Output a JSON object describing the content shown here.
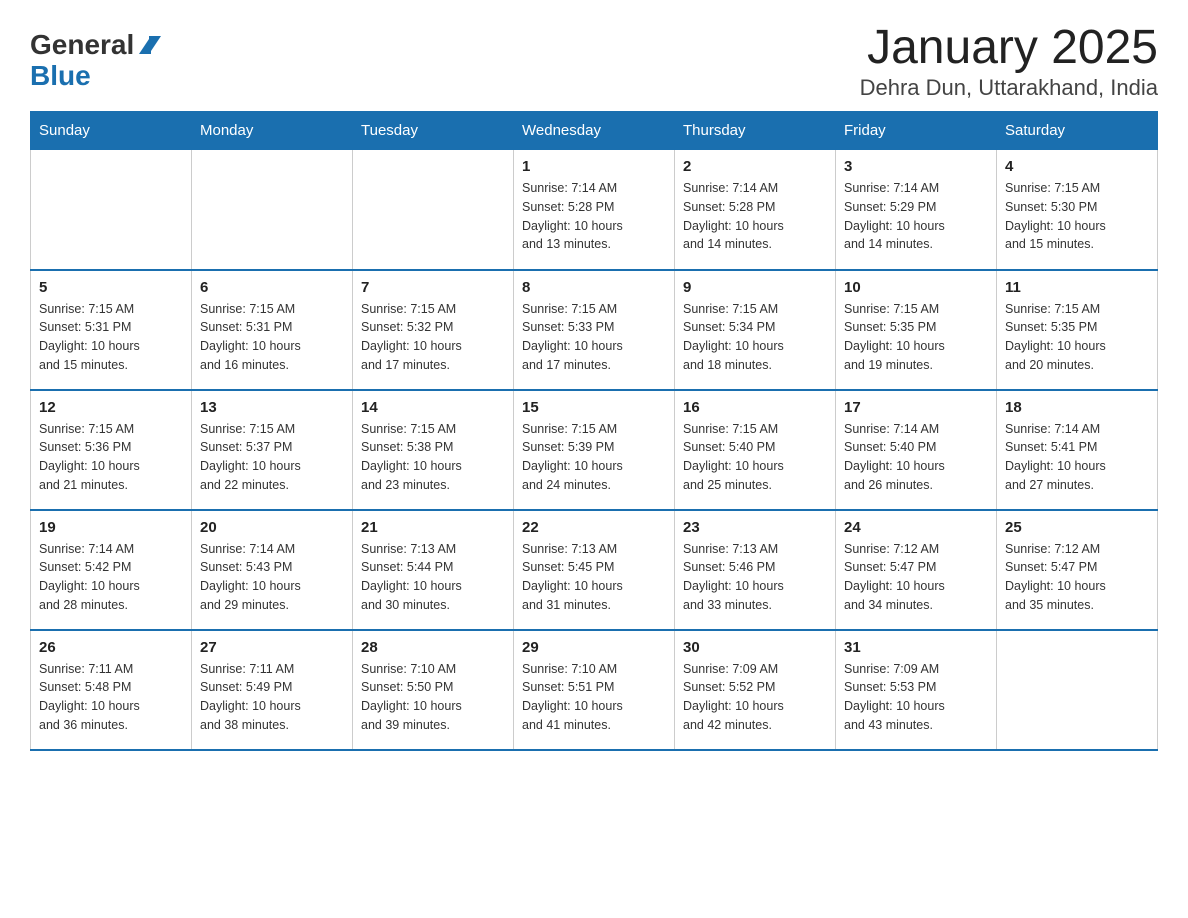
{
  "header": {
    "title": "January 2025",
    "subtitle": "Dehra Dun, Uttarakhand, India",
    "logo_general": "General",
    "logo_blue": "Blue"
  },
  "columns": [
    "Sunday",
    "Monday",
    "Tuesday",
    "Wednesday",
    "Thursday",
    "Friday",
    "Saturday"
  ],
  "weeks": [
    [
      {
        "day": "",
        "info": ""
      },
      {
        "day": "",
        "info": ""
      },
      {
        "day": "",
        "info": ""
      },
      {
        "day": "1",
        "info": "Sunrise: 7:14 AM\nSunset: 5:28 PM\nDaylight: 10 hours\nand 13 minutes."
      },
      {
        "day": "2",
        "info": "Sunrise: 7:14 AM\nSunset: 5:28 PM\nDaylight: 10 hours\nand 14 minutes."
      },
      {
        "day": "3",
        "info": "Sunrise: 7:14 AM\nSunset: 5:29 PM\nDaylight: 10 hours\nand 14 minutes."
      },
      {
        "day": "4",
        "info": "Sunrise: 7:15 AM\nSunset: 5:30 PM\nDaylight: 10 hours\nand 15 minutes."
      }
    ],
    [
      {
        "day": "5",
        "info": "Sunrise: 7:15 AM\nSunset: 5:31 PM\nDaylight: 10 hours\nand 15 minutes."
      },
      {
        "day": "6",
        "info": "Sunrise: 7:15 AM\nSunset: 5:31 PM\nDaylight: 10 hours\nand 16 minutes."
      },
      {
        "day": "7",
        "info": "Sunrise: 7:15 AM\nSunset: 5:32 PM\nDaylight: 10 hours\nand 17 minutes."
      },
      {
        "day": "8",
        "info": "Sunrise: 7:15 AM\nSunset: 5:33 PM\nDaylight: 10 hours\nand 17 minutes."
      },
      {
        "day": "9",
        "info": "Sunrise: 7:15 AM\nSunset: 5:34 PM\nDaylight: 10 hours\nand 18 minutes."
      },
      {
        "day": "10",
        "info": "Sunrise: 7:15 AM\nSunset: 5:35 PM\nDaylight: 10 hours\nand 19 minutes."
      },
      {
        "day": "11",
        "info": "Sunrise: 7:15 AM\nSunset: 5:35 PM\nDaylight: 10 hours\nand 20 minutes."
      }
    ],
    [
      {
        "day": "12",
        "info": "Sunrise: 7:15 AM\nSunset: 5:36 PM\nDaylight: 10 hours\nand 21 minutes."
      },
      {
        "day": "13",
        "info": "Sunrise: 7:15 AM\nSunset: 5:37 PM\nDaylight: 10 hours\nand 22 minutes."
      },
      {
        "day": "14",
        "info": "Sunrise: 7:15 AM\nSunset: 5:38 PM\nDaylight: 10 hours\nand 23 minutes."
      },
      {
        "day": "15",
        "info": "Sunrise: 7:15 AM\nSunset: 5:39 PM\nDaylight: 10 hours\nand 24 minutes."
      },
      {
        "day": "16",
        "info": "Sunrise: 7:15 AM\nSunset: 5:40 PM\nDaylight: 10 hours\nand 25 minutes."
      },
      {
        "day": "17",
        "info": "Sunrise: 7:14 AM\nSunset: 5:40 PM\nDaylight: 10 hours\nand 26 minutes."
      },
      {
        "day": "18",
        "info": "Sunrise: 7:14 AM\nSunset: 5:41 PM\nDaylight: 10 hours\nand 27 minutes."
      }
    ],
    [
      {
        "day": "19",
        "info": "Sunrise: 7:14 AM\nSunset: 5:42 PM\nDaylight: 10 hours\nand 28 minutes."
      },
      {
        "day": "20",
        "info": "Sunrise: 7:14 AM\nSunset: 5:43 PM\nDaylight: 10 hours\nand 29 minutes."
      },
      {
        "day": "21",
        "info": "Sunrise: 7:13 AM\nSunset: 5:44 PM\nDaylight: 10 hours\nand 30 minutes."
      },
      {
        "day": "22",
        "info": "Sunrise: 7:13 AM\nSunset: 5:45 PM\nDaylight: 10 hours\nand 31 minutes."
      },
      {
        "day": "23",
        "info": "Sunrise: 7:13 AM\nSunset: 5:46 PM\nDaylight: 10 hours\nand 33 minutes."
      },
      {
        "day": "24",
        "info": "Sunrise: 7:12 AM\nSunset: 5:47 PM\nDaylight: 10 hours\nand 34 minutes."
      },
      {
        "day": "25",
        "info": "Sunrise: 7:12 AM\nSunset: 5:47 PM\nDaylight: 10 hours\nand 35 minutes."
      }
    ],
    [
      {
        "day": "26",
        "info": "Sunrise: 7:11 AM\nSunset: 5:48 PM\nDaylight: 10 hours\nand 36 minutes."
      },
      {
        "day": "27",
        "info": "Sunrise: 7:11 AM\nSunset: 5:49 PM\nDaylight: 10 hours\nand 38 minutes."
      },
      {
        "day": "28",
        "info": "Sunrise: 7:10 AM\nSunset: 5:50 PM\nDaylight: 10 hours\nand 39 minutes."
      },
      {
        "day": "29",
        "info": "Sunrise: 7:10 AM\nSunset: 5:51 PM\nDaylight: 10 hours\nand 41 minutes."
      },
      {
        "day": "30",
        "info": "Sunrise: 7:09 AM\nSunset: 5:52 PM\nDaylight: 10 hours\nand 42 minutes."
      },
      {
        "day": "31",
        "info": "Sunrise: 7:09 AM\nSunset: 5:53 PM\nDaylight: 10 hours\nand 43 minutes."
      },
      {
        "day": "",
        "info": ""
      }
    ]
  ]
}
